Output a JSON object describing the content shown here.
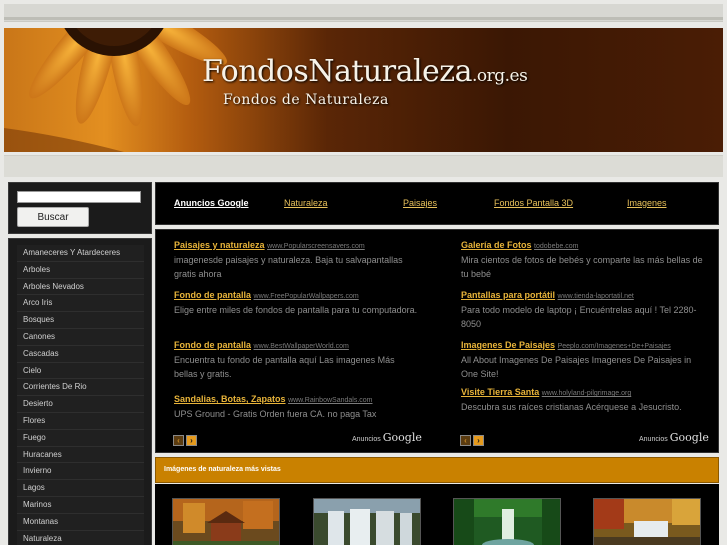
{
  "banner": {
    "title_main": "FondosNaturaleza",
    "title_tld": ".org.es",
    "subtitle": "Fondos de Naturaleza"
  },
  "search": {
    "input_value": "",
    "button_label": "Buscar"
  },
  "categories": [
    "Amaneceres Y Atardeceres",
    "Arboles",
    "Arboles Nevados",
    "Arco Iris",
    "Bosques",
    "Canones",
    "Cascadas",
    "Cielo",
    "Corrientes De Rio",
    "Desierto",
    "Flores",
    "Fuego",
    "Huracanes",
    "Invierno",
    "Lagos",
    "Marinos",
    "Montanas",
    "Naturaleza"
  ],
  "nav": {
    "links": [
      "Anuncios Google",
      "Naturaleza",
      "Paisajes",
      "Fondos Pantalla 3D",
      "Imagenes"
    ]
  },
  "ads": {
    "left": [
      {
        "title": "Paisajes y naturaleza",
        "url": "www.Popularscreensavers.com",
        "desc": "imagenesde paisajes y naturaleza. Baja tu salvapantallas gratis ahora"
      },
      {
        "title": "Fondo de pantalla",
        "url": "www.FreePopularWallpapers.com",
        "desc": "Elige entre miles de fondos de pantalla para tu computadora."
      },
      {
        "title": "Fondo de pantalla",
        "url": "www.BestWallpaperWorld.com",
        "desc": "Encuentra tu fondo de pantalla aquí Las imagenes Más bellas y gratis."
      },
      {
        "title": "Sandalias, Botas, Zapatos",
        "url": "www.RainbowSandals.com",
        "desc": "UPS Ground - Gratis Orden fuera CA. no paga Tax"
      }
    ],
    "right": [
      {
        "title": "Galería de Fotos",
        "url": "todobebe.com",
        "desc": "Mira cientos de fotos de bebés y comparte las más bellas de tu bebé"
      },
      {
        "title": "Pantallas para portátil",
        "url": "www.tienda-laportatil.net",
        "desc": "Para todo modelo de laptop ¡ Encuéntrelas aquí ! Tel 2280-8050"
      },
      {
        "title": "Imagenes De Paisajes",
        "url": "Peeplo.com/Imagenes+De+Paisajes",
        "desc": "All About Imagenes De Paisajes Imagenes De Paisajes in One Site!"
      },
      {
        "title": "Visite Tierra Santa",
        "url": "www.holyland-pilgrimage.org",
        "desc": " Descubra sus raíces cristianas Acérquese a Jesucristo."
      }
    ],
    "ads_by_label": "Anuncios",
    "ads_by_brand": "Google",
    "prev_glyph": "‹",
    "next_glyph": "›"
  },
  "most_viewed": {
    "heading": "Imágenes de naturaleza más vistas"
  },
  "colors": {
    "accent": "#e8b43a",
    "section_bar": "#c98100",
    "panel_bg": "#000000"
  }
}
